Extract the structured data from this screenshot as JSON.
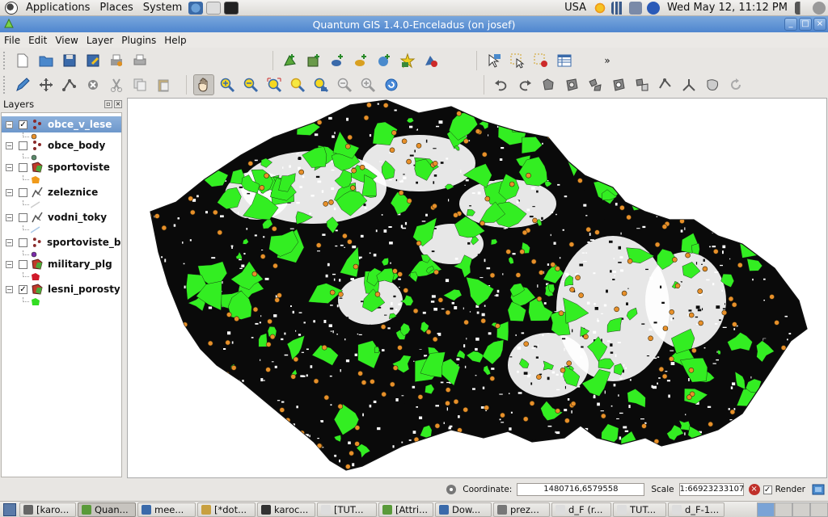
{
  "panel": {
    "menus": [
      "Applications",
      "Places",
      "System"
    ],
    "keyboard_layout": "USA",
    "datetime": "Wed May 12, 11:12 PM"
  },
  "window": {
    "title": "Quantum GIS 1.4.0-Enceladus (on josef)"
  },
  "menubar": [
    "File",
    "Edit",
    "View",
    "Layer",
    "Plugins",
    "Help"
  ],
  "toolbar": {
    "file_tools": [
      "new-project-icon",
      "open-project-icon",
      "save-project-icon",
      "save-as-icon",
      "print-composer-icon",
      "print-icon"
    ],
    "layer_tools": [
      "add-vector-layer-icon",
      "add-raster-layer-icon",
      "add-postgis-layer-icon",
      "add-spatialite-layer-icon",
      "add-wms-layer-icon",
      "new-shapefile-icon",
      "remove-layer-icon"
    ],
    "attribute_tools": [
      "identify-icon",
      "select-features-icon",
      "deselect-icon",
      "attribute-table-icon"
    ],
    "more_label": "»",
    "edit_tools": [
      "toggle-editing-icon",
      "capture-point-icon",
      "node-tool-icon",
      "delete-selected-icon",
      "cut-features-icon",
      "copy-features-icon",
      "paste-features-icon"
    ],
    "nav_tools": [
      "pan-icon",
      "zoom-in-icon",
      "zoom-out-icon",
      "zoom-full-icon",
      "zoom-selection-icon",
      "zoom-layer-icon",
      "zoom-last-icon",
      "zoom-next-icon",
      "refresh-icon"
    ],
    "digitize_tools": [
      "undo-icon",
      "redo-icon",
      "simplify-icon",
      "add-ring-icon",
      "add-island-icon",
      "delete-ring-icon",
      "delete-part-icon",
      "reshape-icon",
      "split-icon",
      "merge-icon",
      "rotate-icon",
      "offset-icon"
    ]
  },
  "layers_panel": {
    "title": "Layers",
    "layers": [
      {
        "name": "obce_v_lese",
        "checked": true,
        "type": "point",
        "selected": true,
        "legend_color": "#e8902a"
      },
      {
        "name": "obce_body",
        "checked": false,
        "type": "point",
        "selected": false,
        "legend_color": "#5a8a6a"
      },
      {
        "name": "sportoviste",
        "checked": false,
        "type": "polygon",
        "selected": false,
        "legend_color": "#f09a1a"
      },
      {
        "name": "zeleznice",
        "checked": false,
        "type": "line",
        "selected": false,
        "legend_color": "#cccccc"
      },
      {
        "name": "vodni_toky",
        "checked": false,
        "type": "line",
        "selected": false,
        "legend_color": "#aac8e8"
      },
      {
        "name": "sportoviste_b...",
        "checked": false,
        "type": "point",
        "selected": false,
        "legend_color": "#7a2aa8"
      },
      {
        "name": "military_plg",
        "checked": false,
        "type": "polygon",
        "selected": false,
        "legend_color": "#d01a2a"
      },
      {
        "name": "lesni_porosty",
        "checked": true,
        "type": "polygon",
        "selected": false,
        "legend_color": "#33dd22"
      }
    ]
  },
  "map": {
    "forest_color": "#33ee22",
    "dark_fill": "#0a0a0a",
    "point_color": "#e8902a",
    "background": "#ffffff"
  },
  "statusbar": {
    "coordinate_label": "Coordinate:",
    "coordinate_value": "1480716,6579558",
    "scale_label": "Scale",
    "scale_value": "1:66923233107",
    "render_label": "Render",
    "render_checked": "✓"
  },
  "taskbar": {
    "tasks": [
      {
        "label": "[karo...",
        "active": false,
        "color": "#666"
      },
      {
        "label": "Quan...",
        "active": true,
        "color": "#5a9a3a"
      },
      {
        "label": "mee...",
        "active": false,
        "color": "#3a6aaa"
      },
      {
        "label": "[*dot...",
        "active": false,
        "color": "#c8a040"
      },
      {
        "label": "karoc...",
        "active": false,
        "color": "#333"
      },
      {
        "label": "[TUT...",
        "active": false,
        "color": "#ddd"
      },
      {
        "label": "[Attri...",
        "active": false,
        "color": "#5a9a3a"
      },
      {
        "label": "Dow...",
        "active": false,
        "color": "#3a6aaa"
      },
      {
        "label": "prez...",
        "active": false,
        "color": "#777"
      },
      {
        "label": "d_F (r...",
        "active": false,
        "color": "#ddd"
      },
      {
        "label": "TUT...",
        "active": false,
        "color": "#ddd"
      },
      {
        "label": "d_F-1...",
        "active": false,
        "color": "#ddd"
      }
    ]
  }
}
